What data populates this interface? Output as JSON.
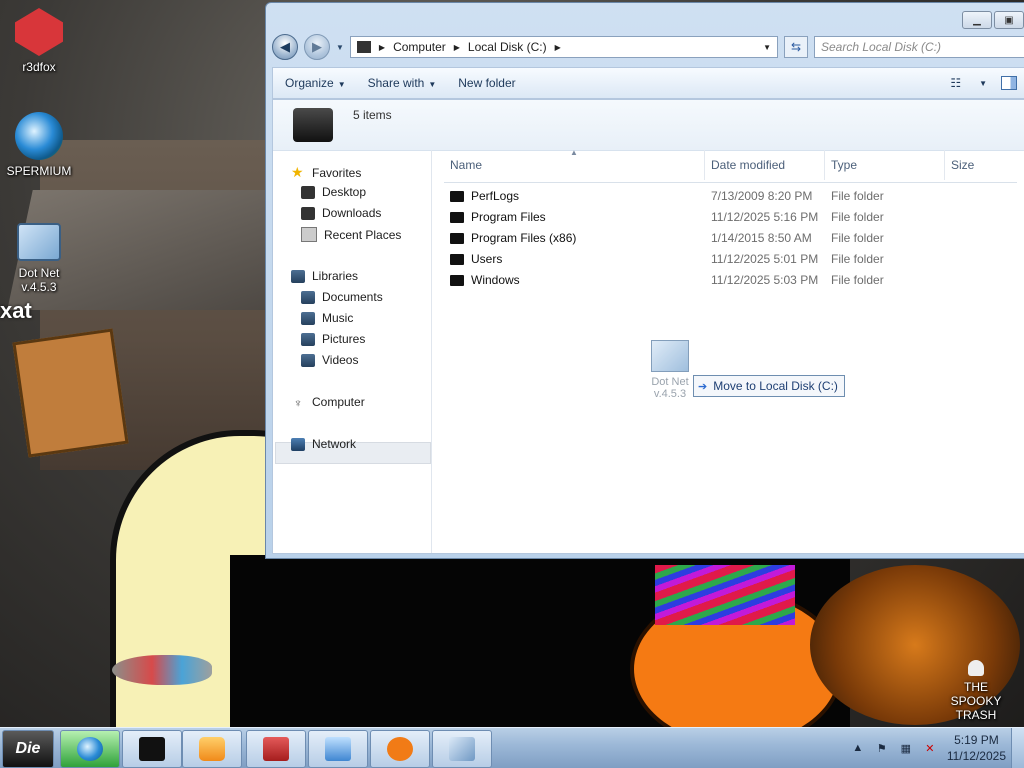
{
  "desktop": {
    "icons": [
      {
        "label": "r3dfox"
      },
      {
        "label": "SPERMIUM"
      },
      {
        "label": "Dot Net\nv.4.5.3"
      },
      {
        "label": "THE SPOOKY\nTRASH"
      }
    ],
    "wallpaper_text": "xat"
  },
  "window": {
    "breadcrumb": [
      "Computer",
      "Local Disk (C:)"
    ],
    "search_placeholder": "Search Local Disk (C:)",
    "toolbar": {
      "organize": "Organize",
      "share_with": "Share with",
      "new_folder": "New folder"
    },
    "item_count": "5 items",
    "nav": {
      "favorites": {
        "label": "Favorites",
        "items": [
          "Desktop",
          "Downloads",
          "Recent Places"
        ]
      },
      "libraries": {
        "label": "Libraries",
        "items": [
          "Documents",
          "Music",
          "Pictures",
          "Videos"
        ]
      },
      "computer": "Computer",
      "network": "Network"
    },
    "columns": {
      "name": "Name",
      "date": "Date modified",
      "type": "Type",
      "size": "Size"
    },
    "files": [
      {
        "name": "PerfLogs",
        "date": "7/13/2009 8:20 PM",
        "type": "File folder"
      },
      {
        "name": "Program Files",
        "date": "11/12/2025 5:16 PM",
        "type": "File folder"
      },
      {
        "name": "Program Files (x86)",
        "date": "1/14/2015 8:50 AM",
        "type": "File folder"
      },
      {
        "name": "Users",
        "date": "11/12/2025 5:01 PM",
        "type": "File folder"
      },
      {
        "name": "Windows",
        "date": "11/12/2025 5:03 PM",
        "type": "File folder"
      }
    ],
    "drag": {
      "ghost_label": "Dot Net\nv.4.5.3",
      "tooltip": "Move to Local Disk (C:)"
    }
  },
  "taskbar": {
    "start_label": "Die",
    "clock_time": "5:19 PM",
    "clock_date": "11/12/2025"
  },
  "colors": {
    "accent": "#2b6ad0",
    "taskbar": "#9db9d8"
  }
}
